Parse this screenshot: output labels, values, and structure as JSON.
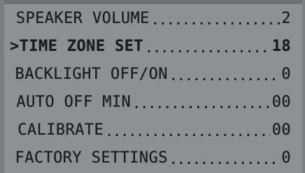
{
  "menu": {
    "items": [
      {
        "label": "SPEAKER VOLUME",
        "value": "2",
        "leader": "......................................",
        "cursor": ""
      },
      {
        "label": "TIME ZONE SET ",
        "value": "18",
        "leader": "......................................",
        "cursor": ">"
      },
      {
        "label": "BACKLIGHT OFF/ON",
        "value": "0",
        "leader": "......................................",
        "cursor": ""
      },
      {
        "label": "AUTO OFF MIN",
        "value": "00",
        "leader": "......................................",
        "cursor": ""
      },
      {
        "label": "CALIBRATE",
        "value": "00",
        "leader": "......................................",
        "cursor": ""
      },
      {
        "label": "FACTORY SETTINGS",
        "value": "0",
        "leader": "......................................",
        "cursor": ""
      }
    ],
    "selected_index": 1
  },
  "colors": {
    "screen_background": "#8e9093",
    "text": "#1c1d1f"
  }
}
